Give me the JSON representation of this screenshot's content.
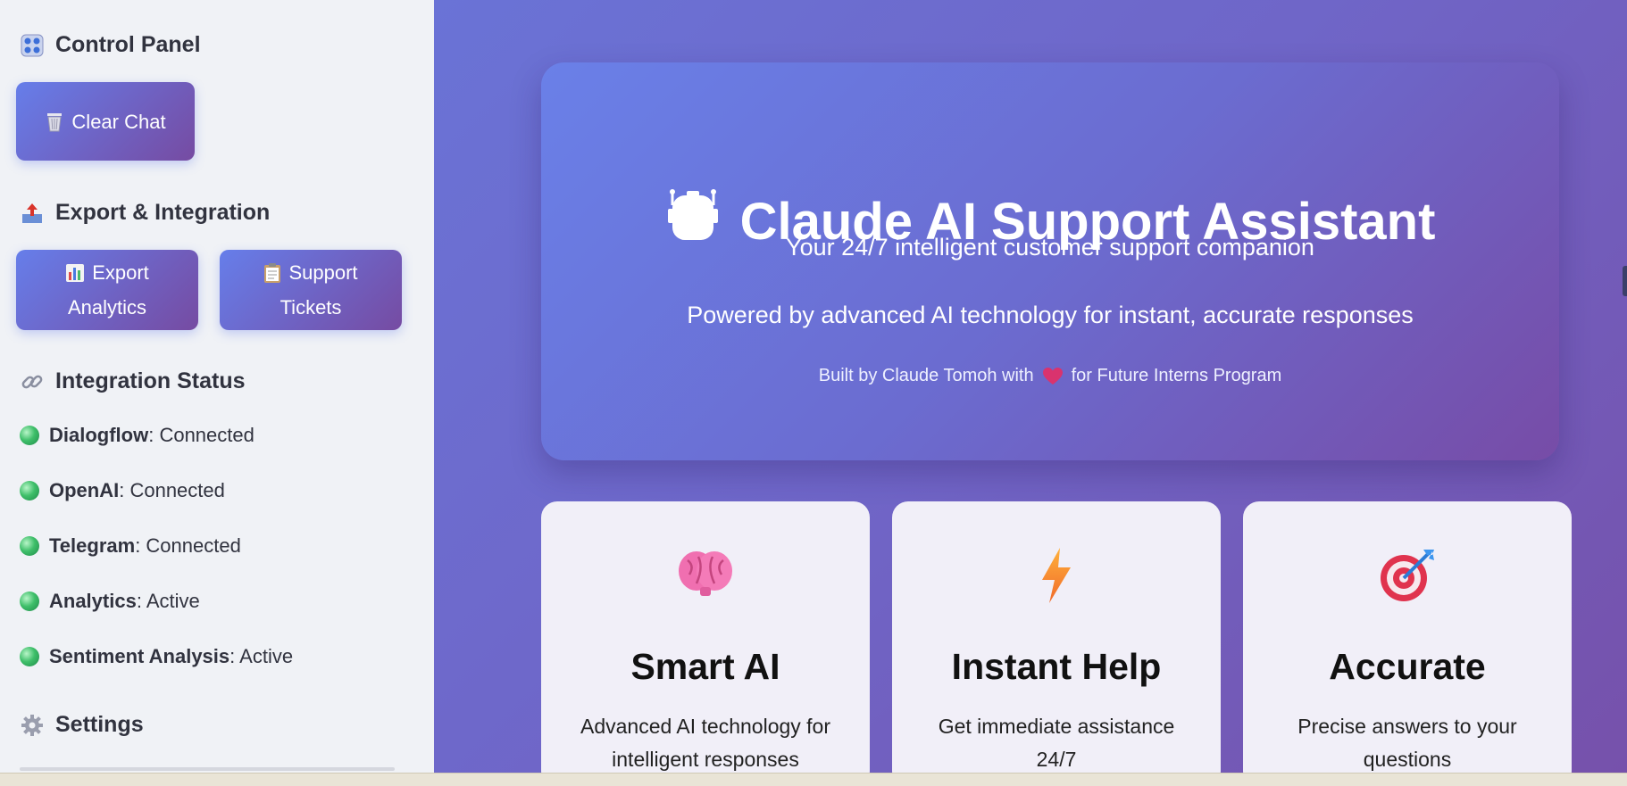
{
  "sidebar": {
    "control_panel": {
      "heading": "Control Panel",
      "icon": "control-knobs-icon",
      "clear_chat": "Clear Chat",
      "clear_icon": "wastebasket-icon"
    },
    "export": {
      "heading": "Export & Integration",
      "icon": "outbox-tray-icon",
      "export_line1": "Export",
      "export_line2": "Analytics",
      "export_icon": "bar-chart-icon",
      "tickets_line1": "Support",
      "tickets_line2": "Tickets",
      "tickets_icon": "clipboard-icon"
    },
    "integration": {
      "heading": "Integration Status",
      "icon": "link-icon",
      "items": [
        {
          "name": "Dialogflow",
          "status": ": Connected"
        },
        {
          "name": "OpenAI",
          "status": ": Connected"
        },
        {
          "name": "Telegram",
          "status": ": Connected"
        },
        {
          "name": "Analytics",
          "status": ": Active"
        },
        {
          "name": "Sentiment Analysis",
          "status": ": Active"
        }
      ]
    },
    "settings": {
      "heading": "Settings",
      "icon": "gear-icon"
    }
  },
  "hero": {
    "icon": "robot-icon",
    "title": "Claude AI Support Assistant",
    "subtitle": "Your 24/7 intelligent customer support companion",
    "tagline": "Powered by advanced AI technology for instant, accurate responses",
    "credit_before": "Built by Claude Tomoh with",
    "credit_icon": "heart-icon",
    "credit_after": "for Future Interns Program"
  },
  "features": [
    {
      "icon": "brain-icon",
      "title": "Smart AI",
      "desc_line1": "Advanced AI technology for",
      "desc_line2": "intelligent responses"
    },
    {
      "icon": "lightning-icon",
      "title": "Instant Help",
      "desc_line1": "Get immediate assistance 24/7",
      "desc_line2": ""
    },
    {
      "icon": "target-icon",
      "title": "Accurate",
      "desc_line1": "Precise answers to your",
      "desc_line2": "questions"
    }
  ],
  "colors": {
    "accent_start": "#667eea",
    "accent_end": "#764ba2",
    "status_green": "#3fbf6a",
    "sidebar_bg": "#f0f2f6"
  }
}
